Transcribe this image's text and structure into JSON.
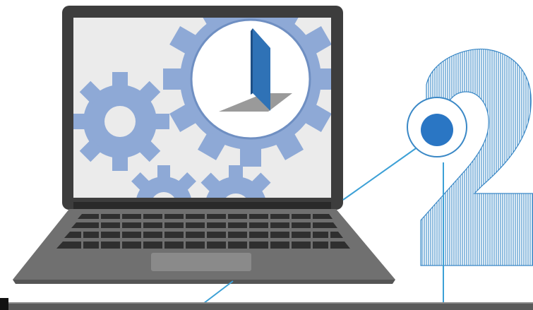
{
  "illustration": {
    "big_numeral": "2",
    "colors": {
      "screen_bg": "#ebebeb",
      "bezel": "#3d3d3d",
      "gear": "#8ea9d6",
      "clock_face": "#ffffff",
      "clock_hand": "#2f72b6",
      "clock_shadow": "#9a9a9a",
      "laptop_base": "#707070",
      "key": "#2f2f2f",
      "trackpad": "#8a8a8a",
      "connector_line": "#3ca0d6",
      "callout_dot": "#2a76c4",
      "numeral_stroke": "#3a88c6",
      "baseline": "#5a5a5a"
    }
  }
}
